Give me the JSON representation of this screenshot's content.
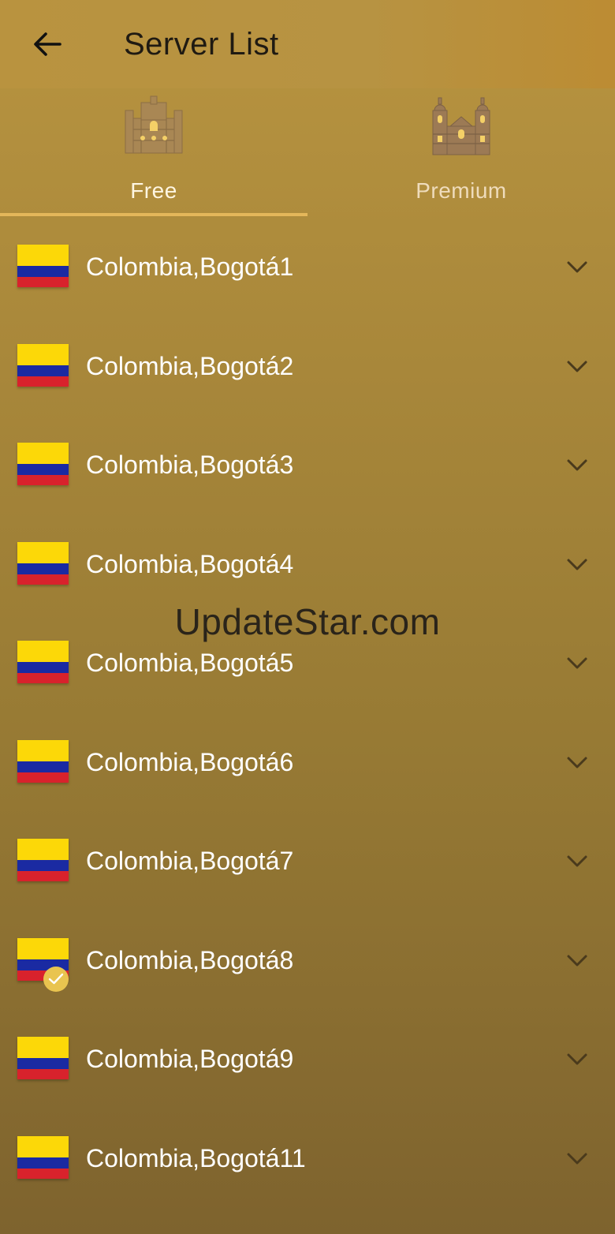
{
  "header": {
    "title": "Server List",
    "back_icon": "arrow-left-icon"
  },
  "tabs": [
    {
      "label": "Free",
      "icon": "cathedral-icon",
      "selected": true
    },
    {
      "label": "Premium",
      "icon": "cathedral-twin-towers-icon",
      "selected": false
    }
  ],
  "colors": {
    "accent": "#e4b75a",
    "background_top": "#b89440",
    "background_bottom": "#7e632e",
    "flag_yellow": "#fcd808",
    "flag_blue": "#1a2aa2",
    "flag_red": "#d8222c"
  },
  "servers": [
    {
      "name": "Colombia,Bogotá1",
      "flag": "colombia-flag",
      "selected": false
    },
    {
      "name": "Colombia,Bogotá2",
      "flag": "colombia-flag",
      "selected": false
    },
    {
      "name": "Colombia,Bogotá3",
      "flag": "colombia-flag",
      "selected": false
    },
    {
      "name": "Colombia,Bogotá4",
      "flag": "colombia-flag",
      "selected": false
    },
    {
      "name": "Colombia,Bogotá5",
      "flag": "colombia-flag",
      "selected": false
    },
    {
      "name": "Colombia,Bogotá6",
      "flag": "colombia-flag",
      "selected": false
    },
    {
      "name": "Colombia,Bogotá7",
      "flag": "colombia-flag",
      "selected": false
    },
    {
      "name": "Colombia,Bogotá8",
      "flag": "colombia-flag",
      "selected": true
    },
    {
      "name": "Colombia,Bogotá9",
      "flag": "colombia-flag",
      "selected": false
    },
    {
      "name": "Colombia,Bogotá11",
      "flag": "colombia-flag",
      "selected": false
    }
  ],
  "watermark": "UpdateStar.com"
}
